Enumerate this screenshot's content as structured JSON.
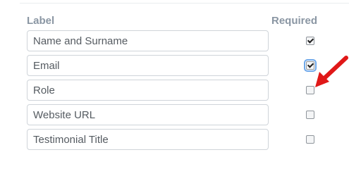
{
  "headers": {
    "label": "Label",
    "required": "Required"
  },
  "rows": [
    {
      "label": "Name and Surname",
      "required": true
    },
    {
      "label": "Email",
      "required": true
    },
    {
      "label": "Role",
      "required": false
    },
    {
      "label": "Website URL",
      "required": false
    },
    {
      "label": "Testimonial Title",
      "required": false
    }
  ],
  "colors": {
    "header_text": "#8a96a3",
    "field_border": "#cfd4d9",
    "focus_outline": "#6fa8ea",
    "annotation_arrow": "#e01818"
  },
  "icons": {
    "annotation": "red-arrow-icon",
    "checkbox": "checkbox-icon"
  }
}
